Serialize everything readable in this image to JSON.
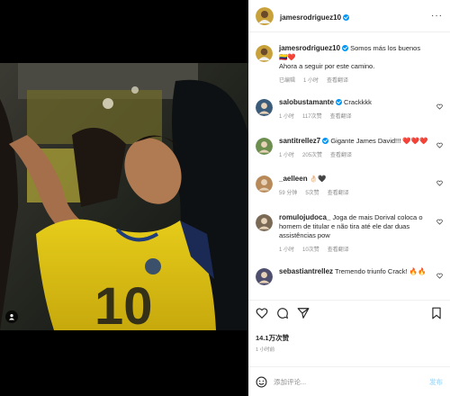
{
  "post": {
    "author": "jamesrodriguez10",
    "caption": "Somos más los buenos 🇨🇴❤️\nAhora a seguir por este camino.",
    "caption_meta": {
      "edited": "已编辑",
      "time": "1 小时",
      "translate": "查看翻译"
    },
    "likes": "14.1万次赞",
    "time": "1 小时前"
  },
  "comments": [
    {
      "user": "salobustamante",
      "text": "Crackkkk",
      "verified": true,
      "time": "1 小时",
      "likes": "117次赞",
      "translate": "查看翻译"
    },
    {
      "user": "santitrellez7",
      "text": "Gigante James David!!! ❤️❤️❤️",
      "verified": true,
      "time": "1 小时",
      "likes": "205次赞",
      "translate": "查看翻译"
    },
    {
      "user": "_aelleen",
      "text": "👌🏻🖤",
      "verified": false,
      "time": "59 分钟",
      "likes": "5次赞",
      "translate": "查看翻译"
    },
    {
      "user": "romulojudoca_",
      "text": "Joga de mais Dorival coloca o homem de titular e não tira até ele dar duas assistências pow",
      "verified": false,
      "time": "1 小时",
      "likes": "10次赞",
      "translate": "查看翻译"
    },
    {
      "user": "sebastiantrellez",
      "text": "Tremendo triunfo Crack! 🔥🔥",
      "verified": false,
      "time": "",
      "likes": "",
      "translate": ""
    }
  ],
  "composer": {
    "placeholder": "添加评论...",
    "post_label": "发布"
  },
  "icons": {
    "heart": "heart-icon",
    "comment": "comment-icon",
    "share": "share-icon",
    "bookmark": "bookmark-icon",
    "emoji": "emoji-icon",
    "tag": "user-tag-icon"
  },
  "colors": {
    "verified": "#0095f6",
    "jersey": "#f5d316",
    "text": "#262626",
    "muted": "#8e8e8e"
  }
}
